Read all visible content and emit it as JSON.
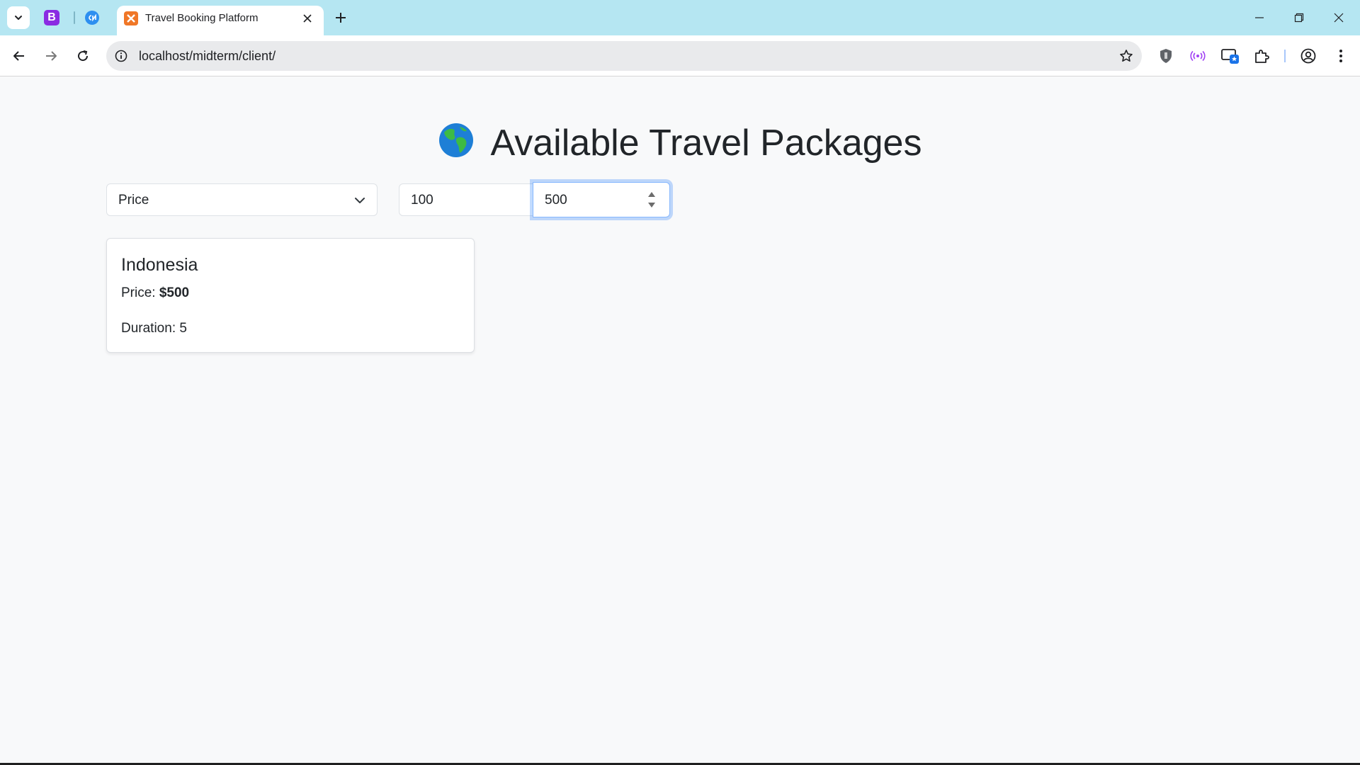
{
  "browser": {
    "pinned_tab_b_letter": "B",
    "active_tab_title": "Travel Booking Platform",
    "address": "localhost/midterm/client/"
  },
  "page": {
    "heading": "Available Travel Packages",
    "filter": {
      "sort_select_value": "Price",
      "min_value": "100",
      "max_value": "500"
    },
    "packages": [
      {
        "name": "Indonesia",
        "price_label": "Price:",
        "price_value": "$500",
        "duration_label": "Duration:",
        "duration_value": "5"
      }
    ]
  },
  "colors": {
    "tabbar": "#b5e6f2",
    "page_background": "#f8f9fa",
    "focus_ring": "#86b7fe"
  }
}
